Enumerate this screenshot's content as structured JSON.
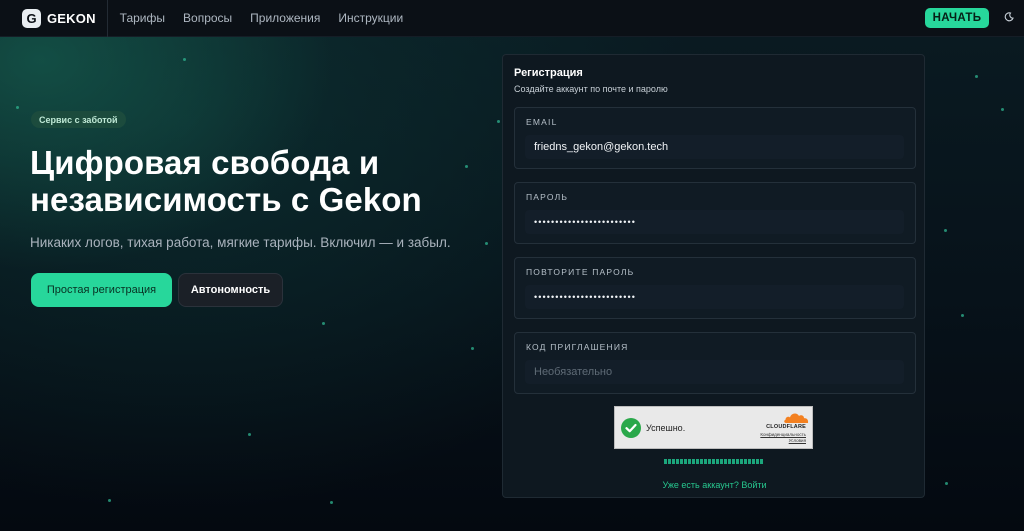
{
  "nav": {
    "logo_letter": "G",
    "logo_text": "GEKON",
    "links": [
      "Тарифы",
      "Вопросы",
      "Приложения",
      "Инструкции"
    ],
    "start_label": "НАЧАТЬ",
    "theme_icon": "moon-icon"
  },
  "hero": {
    "badge": "Сервис с заботой",
    "title_line1": "Цифровая свобода и",
    "title_line2": "независимость с Gekon",
    "subtitle": "Никаких логов, тихая работа, мягкие тарифы. Включил — и забыл.",
    "primary_button": "Простая регистрация",
    "secondary_button": "Автономность"
  },
  "register": {
    "title": "Регистрация",
    "subtitle": "Создайте аккаунт по почте и паролю",
    "email_label": "EMAIL",
    "email_value": "friedns_gekon@gekon.tech",
    "password_label": "ПАРОЛЬ",
    "password_value": "••••••••••••••••••••••••",
    "repeat_label": "ПОВТОРИТЕ ПАРОЛЬ",
    "repeat_value": "••••••••••••••••••••••••",
    "invite_label": "КОД ПРИГЛАШЕНИЯ",
    "invite_placeholder": "Необязательно",
    "login_link": "Уже есть аккаунт? Войти"
  },
  "captcha": {
    "status": "Успешно.",
    "brand": "CLOUDFLARE",
    "privacy": "Конфиденциальность",
    "terms": "Условия"
  },
  "colors": {
    "accent": "#27d79b",
    "background": "#050a12",
    "card": "#0e1820"
  }
}
